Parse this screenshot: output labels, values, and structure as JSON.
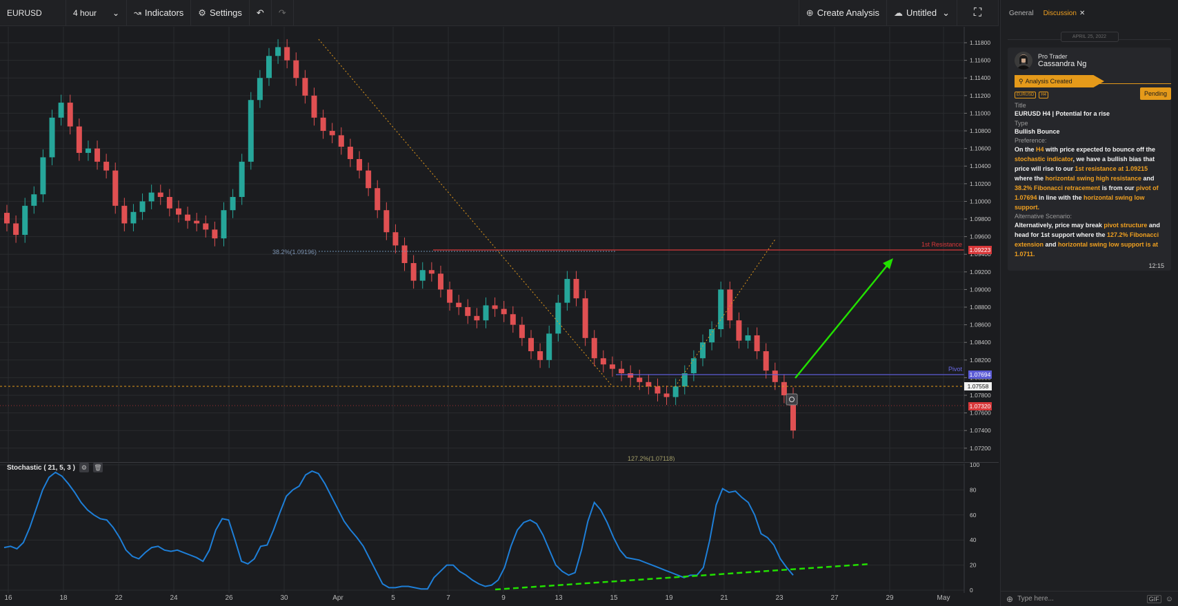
{
  "toolbar": {
    "symbol": "EURUSD",
    "timeframe": "4 hour",
    "indicators_label": "Indicators",
    "settings_label": "Settings",
    "create_analysis_label": "Create Analysis",
    "layout_label": "Untitled",
    "icons": {
      "timeframe": "chevron-down-icon",
      "indicators": "line-chart-icon",
      "settings": "gear-icon",
      "undo": "undo-icon",
      "redo": "redo-icon",
      "create": "plus-circle-icon",
      "cloud": "cloud-icon",
      "layout": "chevron-down-icon",
      "fullscreen": "fullscreen-icon"
    }
  },
  "price_axis_ticks": [
    "1.11800",
    "1.11600",
    "1.11400",
    "1.11200",
    "1.11000",
    "1.10800",
    "1.10600",
    "1.10400",
    "1.10200",
    "1.10000",
    "1.09800",
    "1.09600",
    "1.09400",
    "1.09200",
    "1.09000",
    "1.08800",
    "1.08600",
    "1.08400",
    "1.08200",
    "1.08000",
    "1.07800",
    "1.07600",
    "1.07400",
    "1.07200"
  ],
  "price_axis_ticks_values": [
    1.118,
    1.116,
    1.114,
    1.112,
    1.11,
    1.108,
    1.106,
    1.104,
    1.102,
    1.1,
    1.098,
    1.096,
    1.094,
    1.092,
    1.09,
    1.088,
    1.086,
    1.084,
    1.082,
    1.08,
    1.078,
    1.076,
    1.074,
    1.072
  ],
  "price_tags": {
    "resistance": "1.09223",
    "pivot": "1.07694",
    "current": "1.07558",
    "support": "1.07320"
  },
  "level_labels": {
    "resistance": "1st Resistance",
    "pivot": "Pivot",
    "fib_382": "38.2%(1.09196)",
    "fib_1272": "127.2%(1.07118)"
  },
  "time_ticks": [
    "16",
    "18",
    "22",
    "24",
    "26",
    "30",
    "Apr",
    "5",
    "7",
    "9",
    "13",
    "15",
    "19",
    "21",
    "23",
    "27",
    "29",
    "May"
  ],
  "stochastic": {
    "label": "Stochastic ( 21, 5, 3 )",
    "axis_ticks": [
      "100",
      "80",
      "60",
      "40",
      "20",
      "0"
    ],
    "axis_values": [
      100,
      80,
      60,
      40,
      20,
      0
    ],
    "values": [
      34,
      35,
      33,
      38,
      50,
      65,
      80,
      90,
      94,
      91,
      85,
      78,
      70,
      64,
      60,
      57,
      56,
      50,
      42,
      32,
      27,
      25,
      30,
      34,
      35,
      32,
      31,
      32,
      30,
      28,
      26,
      23,
      32,
      48,
      57,
      56,
      40,
      23,
      21,
      25,
      35,
      36,
      48,
      62,
      75,
      80,
      83,
      92,
      95,
      93,
      85,
      75,
      65,
      55,
      48,
      42,
      35,
      25,
      15,
      5,
      2,
      2,
      3,
      3,
      2,
      1,
      1,
      10,
      15,
      20,
      20,
      15,
      12,
      8,
      5,
      3,
      4,
      8,
      18,
      35,
      48,
      54,
      56,
      53,
      44,
      32,
      20,
      15,
      12,
      14,
      32,
      55,
      70,
      64,
      54,
      42,
      32,
      26,
      25,
      24,
      22,
      20,
      18,
      16,
      14,
      12,
      10,
      12,
      12,
      18,
      40,
      68,
      81,
      78,
      79,
      74,
      70,
      60,
      45,
      42,
      36,
      25,
      18,
      12
    ]
  },
  "chart_data": {
    "type": "candlestick",
    "symbol": "EURUSD",
    "timeframe": "4 hour",
    "series": [
      {
        "name": "EURUSD",
        "values": [
          1.0975,
          1.0962,
          1.0995,
          1.1008,
          1.105,
          1.1095,
          1.1112,
          1.1085,
          1.1055,
          1.106,
          1.1045,
          1.1035,
          1.0995,
          1.0975,
          1.0988,
          1.1,
          1.101,
          1.1005,
          1.0992,
          1.0985,
          1.0978,
          1.0975,
          1.0968,
          1.0958,
          1.099,
          1.1005,
          1.1045,
          1.1115,
          1.114,
          1.1165,
          1.1175,
          1.116,
          1.114,
          1.112,
          1.1095,
          1.108,
          1.1075,
          1.1062,
          1.1048,
          1.1035,
          1.1015,
          1.099,
          1.0965,
          1.095,
          1.093,
          1.091,
          1.0922,
          1.0918,
          1.09,
          1.0885,
          1.088,
          1.087,
          1.0865,
          1.0882,
          1.0878,
          1.0872,
          1.086,
          1.0845,
          1.083,
          1.082,
          1.085,
          1.0885,
          1.0912,
          1.089,
          1.0845,
          1.0822,
          1.0815,
          1.081,
          1.0805,
          1.08,
          1.0795,
          1.079,
          1.0782,
          1.0778,
          1.079,
          1.0805,
          1.0822,
          1.084,
          1.0855,
          1.09,
          1.0865,
          1.0842,
          1.0848,
          1.083,
          1.0808,
          1.0795,
          1.078,
          1.074
        ]
      }
    ],
    "annotations": [
      {
        "type": "hline",
        "label": "1st Resistance",
        "y": 1.09223,
        "color": "#d9383a"
      },
      {
        "type": "hline",
        "label": "Pivot",
        "y": 1.07694,
        "color": "#5c5cd6"
      },
      {
        "type": "hline",
        "label": "38.2%(1.09196)",
        "y": 1.09196,
        "color": "#6e8fb0"
      },
      {
        "type": "hline",
        "label": "127.2%(1.07118)",
        "y": 1.07118,
        "color": "#e59a1a"
      },
      {
        "type": "arrow",
        "color": "#22e000",
        "direction": "up"
      }
    ],
    "ylim": [
      1.0705,
      1.1198
    ],
    "grid": true,
    "colors": {
      "up": "#26a69a",
      "down": "#e05052",
      "bg": "#1b1c1f",
      "grid": "#2a2b2f"
    }
  },
  "sidebar": {
    "tabs": [
      {
        "label": "General"
      },
      {
        "label": "Discussion"
      }
    ],
    "date": "APRIL 25, 2022",
    "author_role": "Pro Trader",
    "author_name": "Cassandra Ng",
    "banner": "Analysis Created",
    "tags": [
      "EURUSD",
      "H4"
    ],
    "status": "Pending",
    "title_label": "Title",
    "title_value": "EURUSD H4 | Potential for a rise",
    "type_label": "Type",
    "type_value": "Bullish Bounce",
    "preference_label": "Preference:",
    "preference_text": [
      {
        "t": "On the "
      },
      {
        "t": "H4",
        "h": true
      },
      {
        "t": " with price expected to bounce off the "
      },
      {
        "t": "stochastic indicator",
        "h": true
      },
      {
        "t": ", we have a bullish bias that price will rise to our "
      },
      {
        "t": "1st resistance at 1.09215",
        "h": true
      },
      {
        "t": " where the "
      },
      {
        "t": "horizontal swing high resistance",
        "h": true
      },
      {
        "t": " and "
      },
      {
        "t": "38.2% Fibonacci retracement",
        "h": true
      },
      {
        "t": " is from our "
      },
      {
        "t": "pivot of 1.07694",
        "h": true
      },
      {
        "t": "  in line with the "
      },
      {
        "t": "horizontal swing low support.",
        "h": true
      }
    ],
    "alternative_label": "Alternative Scenario:",
    "alternative_text": [
      {
        "t": "Alternatively, price may break "
      },
      {
        "t": "pivot structure",
        "h": true
      },
      {
        "t": " and head for 1st support where the "
      },
      {
        "t": "127.2% Fibonacci extension",
        "h": true
      },
      {
        "t": " and "
      },
      {
        "t": "horizontal swing low support is at 1.0711.",
        "h": true
      }
    ],
    "time": "12:15",
    "composer_placeholder": "Type here...",
    "gif_label": "GIF"
  }
}
